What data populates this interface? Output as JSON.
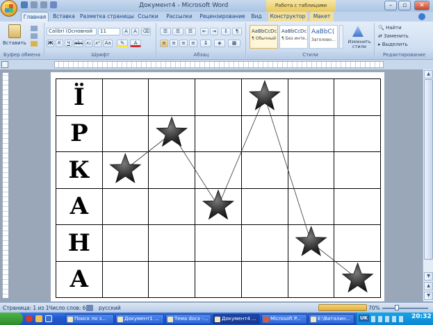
{
  "window": {
    "title": "Документ4 - Microsoft Word",
    "context_tab_group": "Работа с таблицами"
  },
  "tabs": [
    "Главная",
    "Вставка",
    "Разметка страницы",
    "Ссылки",
    "Рассылки",
    "Рецензирование",
    "Вид",
    "Конструктор",
    "Макет"
  ],
  "ribbon": {
    "clipboard": {
      "label": "Буфер обмена",
      "paste": "Вставить"
    },
    "font": {
      "label": "Шрифт",
      "font_name": "Calibri (Основной те",
      "font_size": "11"
    },
    "paragraph": {
      "label": "Абзац"
    },
    "styles": {
      "label": "Стили",
      "items": [
        {
          "preview": "AaBbCcDc",
          "name": "¶ Обычный"
        },
        {
          "preview": "AaBbCcDc",
          "name": "¶ Без инте..."
        },
        {
          "preview": "AaBbC(",
          "name": "Заголово..."
        }
      ],
      "change": "Изменить стили"
    },
    "editing": {
      "label": "Редактирование",
      "find": "Найти",
      "replace": "Заменить",
      "select": "Выделить"
    }
  },
  "document": {
    "letters": [
      "Ї",
      "Р",
      "К",
      "А",
      "Н",
      "А"
    ],
    "columns": 7
  },
  "chart_data": {
    "type": "line",
    "marker": "star",
    "x": [
      2,
      3,
      4,
      5,
      6,
      7
    ],
    "y": [
      "К",
      "Р",
      "А",
      "Ї",
      "Н",
      "А"
    ],
    "row_index": [
      3,
      2,
      4,
      1,
      5,
      6
    ],
    "categories_y": [
      "Ї",
      "Р",
      "К",
      "А",
      "Н",
      "А"
    ]
  },
  "status": {
    "page": "Страница: 1 из 1",
    "words": "Число слов: 6",
    "language": "русский",
    "zoom": "70%"
  },
  "taskbar": {
    "items": [
      "Поиск по з...",
      "Документ1 ...",
      "Тема docx -...",
      "Документ4 ...",
      "Microsoft P...",
      "E:\\Виталин..."
    ],
    "lang": "UK",
    "clock": "20:32"
  }
}
